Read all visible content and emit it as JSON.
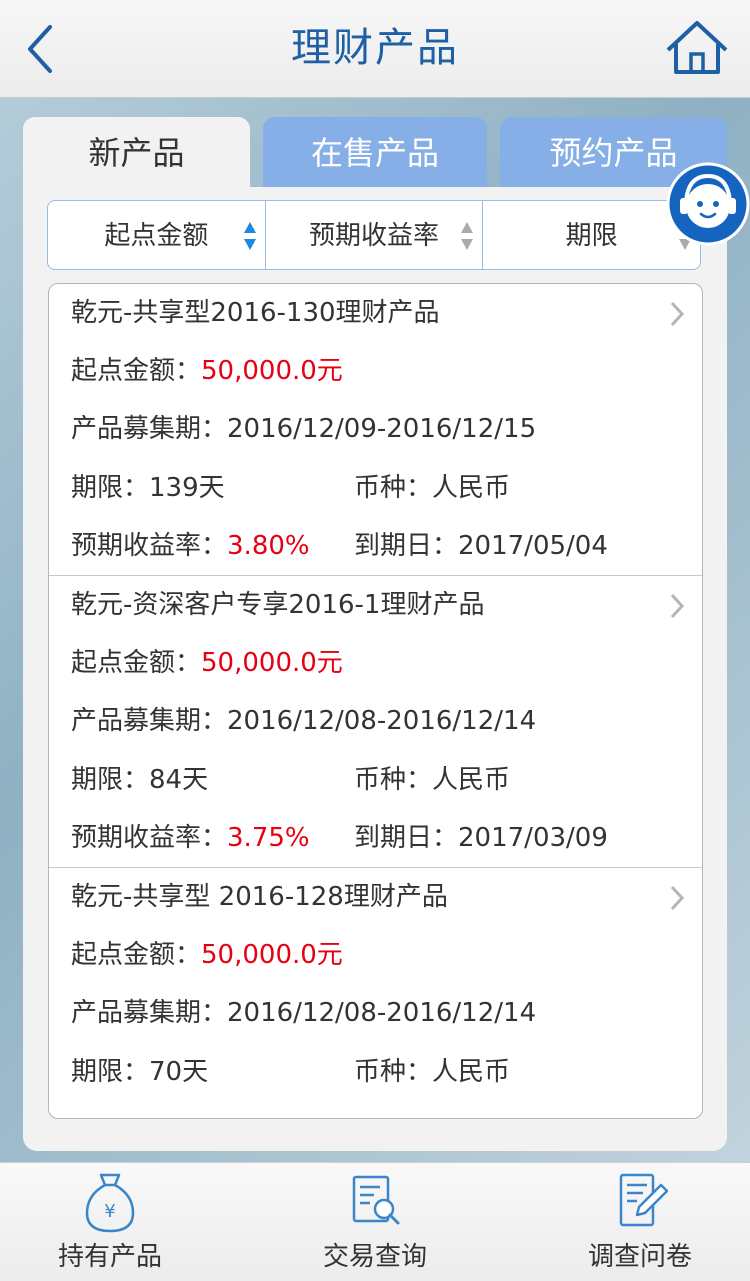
{
  "header": {
    "title": "理财产品",
    "back_icon": "chevron-left-icon",
    "home_icon": "home-icon",
    "accent_color": "#1f5fa6"
  },
  "tabs": [
    {
      "label": "新产品",
      "active": true
    },
    {
      "label": "在售产品",
      "active": false
    },
    {
      "label": "预约产品",
      "active": false
    }
  ],
  "sort_bar": [
    {
      "label": "起点金额",
      "active": true
    },
    {
      "label": "预期收益率",
      "active": false
    },
    {
      "label": "期限",
      "active": false
    }
  ],
  "labels": {
    "min_amount": "起点金额：",
    "raise_period": "产品募集期：",
    "term": "期限：",
    "currency": "币种：",
    "expected_yield": "预期收益率：",
    "maturity": "到期日："
  },
  "products": [
    {
      "name": "乾元-共享型2016-130理财产品",
      "min_amount": "50,000.0元",
      "raise_period": "2016/12/09-2016/12/15",
      "term": "139天",
      "currency": "人民币",
      "expected_yield": "3.80%",
      "maturity": "2017/05/04"
    },
    {
      "name": "乾元-资深客户专享2016-1理财产品",
      "min_amount": "50,000.0元",
      "raise_period": "2016/12/08-2016/12/14",
      "term": "84天",
      "currency": "人民币",
      "expected_yield": "3.75%",
      "maturity": "2017/03/09"
    },
    {
      "name": "乾元-共享型 2016-128理财产品",
      "min_amount": "50,000.0元",
      "raise_period": "2016/12/08-2016/12/14",
      "term": "70天",
      "currency": "人民币"
    }
  ],
  "support_icon": "customer-service-avatar-icon",
  "bottom_nav": [
    {
      "label": "持有产品",
      "icon": "money-bag-icon"
    },
    {
      "label": "交易查询",
      "icon": "document-search-icon"
    },
    {
      "label": "调查问卷",
      "icon": "edit-form-icon"
    }
  ],
  "colors": {
    "highlight_red": "#e60012",
    "tab_inactive": "#86aee7",
    "tab_active": "#f2f2f2"
  }
}
